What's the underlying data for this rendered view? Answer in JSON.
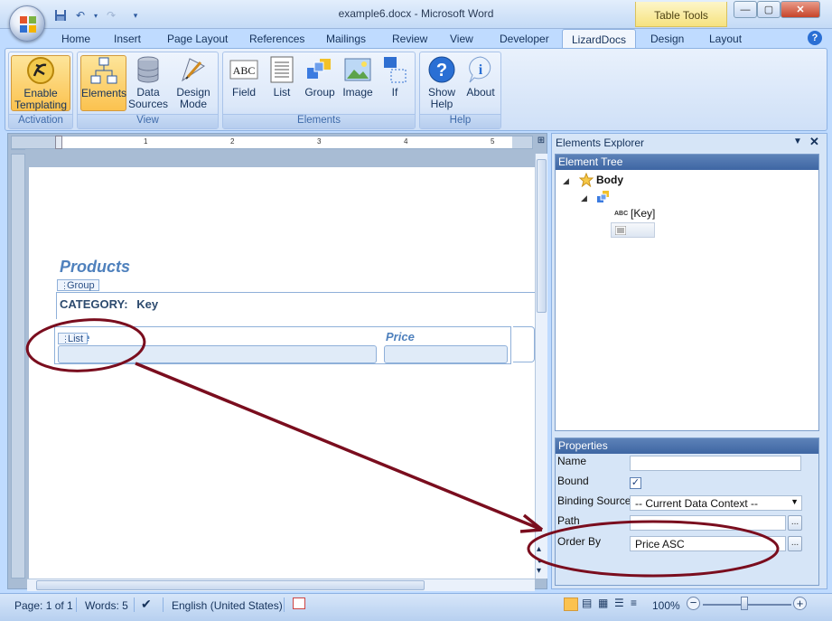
{
  "window": {
    "title": "example6.docx - Microsoft Word",
    "context_tab_group": "Table Tools",
    "controls": {
      "minimize": "—",
      "maximize": "▢",
      "close": "✕"
    }
  },
  "tabs": [
    {
      "label": "Home"
    },
    {
      "label": "Insert"
    },
    {
      "label": "Page Layout"
    },
    {
      "label": "References"
    },
    {
      "label": "Mailings"
    },
    {
      "label": "Review"
    },
    {
      "label": "View"
    },
    {
      "label": "Developer"
    },
    {
      "label": "LizardDocs",
      "active": true
    },
    {
      "label": "Design"
    },
    {
      "label": "Layout"
    }
  ],
  "ribbon": {
    "activation": {
      "label": "Activation",
      "enable_templating": {
        "line1": "Enable",
        "line2": "Templating"
      }
    },
    "view": {
      "label": "View",
      "elements": "Elements",
      "data_sources": {
        "line1": "Data",
        "line2": "Sources"
      },
      "design_mode": {
        "line1": "Design",
        "line2": "Mode"
      }
    },
    "elements": {
      "label": "Elements",
      "field": "Field",
      "list": "List",
      "group": "Group",
      "image": "Image",
      "if": "If"
    },
    "help": {
      "label": "Help",
      "show_help": {
        "line1": "Show",
        "line2": "Help"
      },
      "about": "About"
    }
  },
  "ruler": {
    "numbers": [
      "1",
      "2",
      "3",
      "4",
      "5"
    ]
  },
  "document": {
    "heading": "Products",
    "group_tag": "Group",
    "category_label": "CATEGORY:",
    "category_value": "Key",
    "list_tag": "List",
    "col_name_partial": "e",
    "col_price": "Price"
  },
  "explorer": {
    "title": "Elements Explorer",
    "tree_header": "Element Tree",
    "tree": {
      "root": "Body",
      "field": "[Key]",
      "field_icon": "ABC"
    },
    "properties": {
      "header": "Properties",
      "name_label": "Name",
      "name_value": "",
      "bound_label": "Bound",
      "bound_checked": "✓",
      "binding_source_label": "Binding Source",
      "binding_source_value": "-- Current Data Context --",
      "path_label": "Path",
      "path_value": "",
      "order_by_label": "Order By",
      "order_by_value": "Price ASC",
      "ellipsis": "..."
    }
  },
  "status": {
    "page": "Page: 1 of 1",
    "words": "Words: 5",
    "language": "English (United States)",
    "zoom": "100%"
  },
  "colors": {
    "annotation": "#7a0d1e",
    "accent": "#4f81bd",
    "active_button": "#fbc24f"
  }
}
